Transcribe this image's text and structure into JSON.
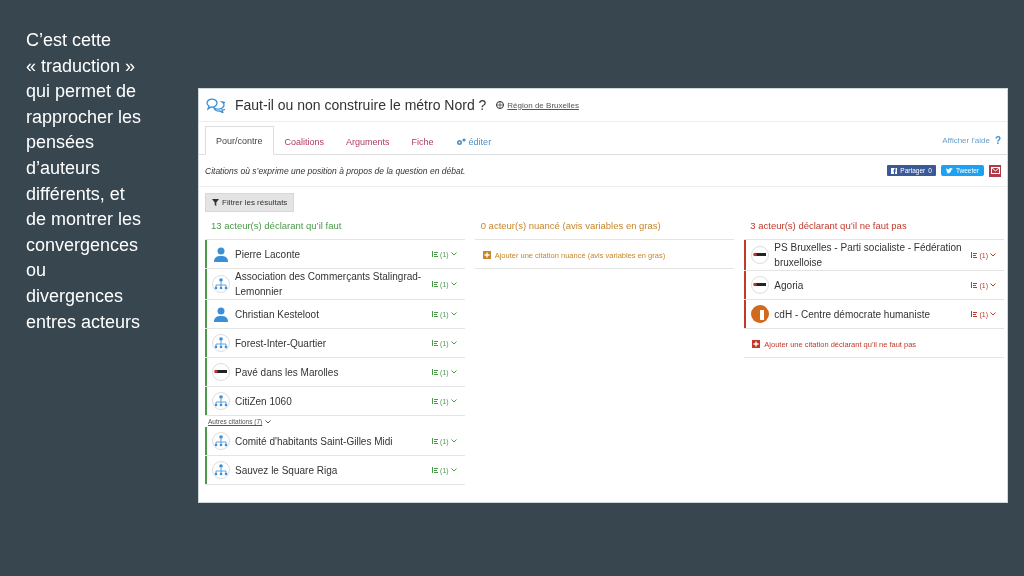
{
  "slide_text": "C’est cette « traduction » qui permet de rapprocher les pensées d’auteurs différents, et de montrer les convergences ou divergences entres acteurs",
  "window": {
    "title": "Faut-il ou non construire le métro Nord ?",
    "region_link": "Région de Bruxelles"
  },
  "tabs": [
    {
      "label": "Pour/contre",
      "selected": true,
      "kind": "tab"
    },
    {
      "label": "Coalitions",
      "selected": false,
      "kind": "tab"
    },
    {
      "label": "Arguments",
      "selected": false,
      "kind": "tab"
    },
    {
      "label": "Fiche",
      "selected": false,
      "kind": "tab"
    },
    {
      "label": "éditer",
      "selected": false,
      "kind": "edit"
    }
  ],
  "help_link": "Afficher l'aide",
  "help_mark": "?",
  "description": "Citations où s’exprime une position à propos de la question en débat.",
  "share": {
    "facebook": "Partager",
    "facebook_count": "0",
    "twitter": "Tweeter"
  },
  "filter_button": "Filtrer les résultats",
  "columns": [
    {
      "heading": "13 acteur(s) déclarant qu’il faut",
      "color": "#4a9a4a",
      "actors": [
        {
          "name": "Pierre Laconte",
          "count": "(1)",
          "kind": "person"
        },
        {
          "name": "Association des Commerçants Stalingrad-Lemonnier",
          "count": "(1)",
          "kind": "org"
        },
        {
          "name": "Christian Kesteloot",
          "count": "(1)",
          "kind": "person"
        },
        {
          "name": "Forest-Inter-Quartier",
          "count": "(1)",
          "kind": "org"
        },
        {
          "name": "Pavé dans les Marolles",
          "count": "(1)",
          "kind": "logo"
        },
        {
          "name": "CitiZen 1060",
          "count": "(1)",
          "kind": "org"
        }
      ],
      "more_link": "Autres citations (7)",
      "more_actors": [
        {
          "name": "Comité d'habitants Saint-Gilles Midi",
          "count": "(1)",
          "kind": "org"
        },
        {
          "name": "Sauvez le Square Riga",
          "count": "(1)",
          "kind": "org"
        }
      ]
    },
    {
      "heading": "0 acteur(s) nuancé (avis variables en gras)",
      "color": "#c8862a",
      "add_link": "Ajouter une citation nuancé (avis variables en gras)"
    },
    {
      "heading": "3 acteur(s) déclarant qu’il ne faut pas",
      "color": "#c0392b",
      "actors": [
        {
          "name": "PS Bruxelles - Parti socialiste - Fédération bruxelloise",
          "count": "(1)",
          "kind": "logo"
        },
        {
          "name": "Agoria",
          "count": "(1)",
          "kind": "logo"
        },
        {
          "name": "cdH - Centre démocrate humaniste",
          "count": "(1)",
          "kind": "party"
        }
      ],
      "add_link": "Ajouter une citation déclarant qu’il ne faut pas"
    }
  ]
}
